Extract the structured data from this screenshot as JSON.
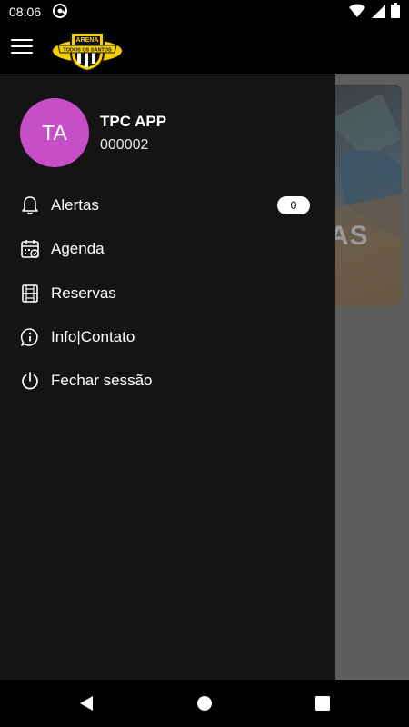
{
  "status_bar": {
    "time": "08:06",
    "icons": [
      "at-sign-icon",
      "wifi-icon",
      "signal-icon",
      "battery-icon"
    ]
  },
  "app_bar": {
    "menu_icon": "hamburger-menu-icon",
    "logo": {
      "line1": "ARENA",
      "line2": "TODOS OS SANTOS"
    }
  },
  "background": {
    "card_text": "AS"
  },
  "drawer": {
    "user": {
      "initials": "TA",
      "name": "TPC APP",
      "id": "000002",
      "avatar_color": "#c64fc8"
    },
    "items": [
      {
        "label": "Alertas",
        "icon": "bell-icon",
        "badge": "0"
      },
      {
        "label": "Agenda",
        "icon": "calendar-check-icon"
      },
      {
        "label": "Reservas",
        "icon": "court-icon"
      },
      {
        "label": "Info|Contato",
        "icon": "info-chat-icon"
      },
      {
        "label": "Fechar sessão",
        "icon": "power-icon"
      }
    ]
  },
  "nav_bar": {
    "buttons": [
      "back-icon",
      "home-icon",
      "recents-icon"
    ]
  },
  "colors": {
    "drawer_bg": "#141414",
    "scrim": "#5e5e5e",
    "logo_yellow": "#f5d000"
  }
}
